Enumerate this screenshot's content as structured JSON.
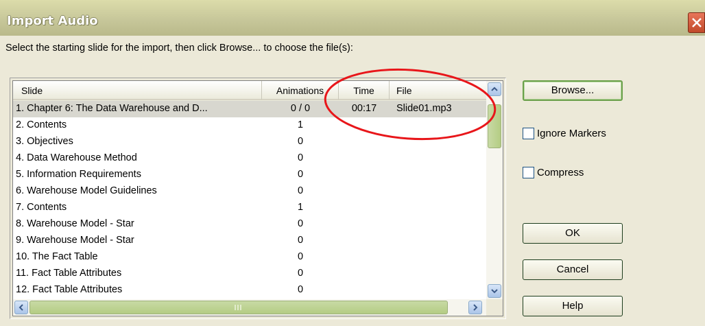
{
  "window": {
    "title": "Import Audio"
  },
  "instruction": "Select the starting slide for the import, then click Browse... to choose the file(s):",
  "table": {
    "columns": [
      "Slide",
      "Animations",
      "Time",
      "File"
    ],
    "rows": [
      {
        "slide": "1. Chapter 6: The Data Warehouse and D...",
        "animations": "0 / 0",
        "time": "00:17",
        "file": "Slide01.mp3"
      },
      {
        "slide": "2. Contents",
        "animations": "1",
        "time": "",
        "file": ""
      },
      {
        "slide": "3. Objectives",
        "animations": "0",
        "time": "",
        "file": ""
      },
      {
        "slide": "4. Data Warehouse Method",
        "animations": "0",
        "time": "",
        "file": ""
      },
      {
        "slide": "5. Information Requirements",
        "animations": "0",
        "time": "",
        "file": ""
      },
      {
        "slide": "6. Warehouse Model Guidelines",
        "animations": "0",
        "time": "",
        "file": ""
      },
      {
        "slide": "7. Contents",
        "animations": "1",
        "time": "",
        "file": ""
      },
      {
        "slide": "8. Warehouse Model - Star",
        "animations": "0",
        "time": "",
        "file": ""
      },
      {
        "slide": "9. Warehouse Model - Star",
        "animations": "0",
        "time": "",
        "file": ""
      },
      {
        "slide": "10. The Fact Table",
        "animations": "0",
        "time": "",
        "file": ""
      },
      {
        "slide": "11. Fact Table Attributes",
        "animations": "0",
        "time": "",
        "file": ""
      },
      {
        "slide": "12. Fact Table Attributes",
        "animations": "0",
        "time": "",
        "file": ""
      }
    ]
  },
  "buttons": {
    "browse": "Browse...",
    "ok": "OK",
    "cancel": "Cancel",
    "help": "Help"
  },
  "options": {
    "ignore_markers": "Ignore Markers",
    "compress": "Compress"
  },
  "icons": {
    "close": "close-icon",
    "up": "arrow-up-icon",
    "down": "arrow-down-icon",
    "left": "arrow-left-icon",
    "right": "arrow-right-icon"
  },
  "colors": {
    "annotation": "#e8161a",
    "close": "#d0583a"
  }
}
